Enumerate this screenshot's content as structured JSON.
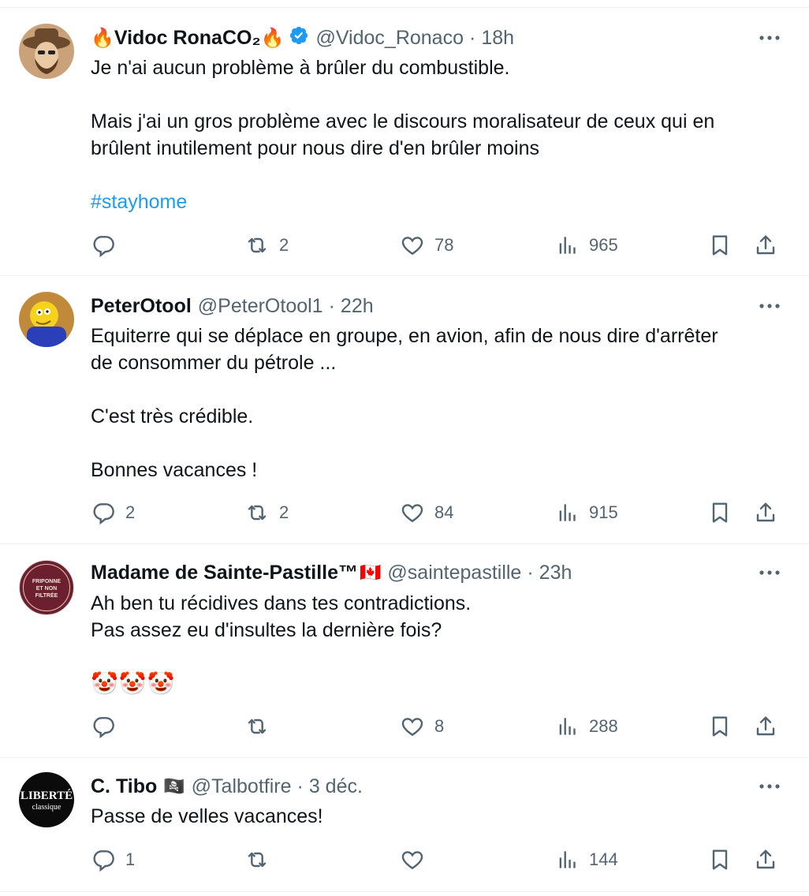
{
  "tweets": [
    {
      "name": "Vidoc RonaCO₂",
      "name_prefix_emoji": "🔥",
      "name_suffix_emoji": "🔥",
      "verified": true,
      "handle": "@Vidoc_Ronaco",
      "time": "18h",
      "paragraphs": [
        "Je n'ai aucun problème à brûler du combustible.",
        "Mais j'ai un gros problème avec le discours moralisateur de ceux qui en",
        "brûlent inutilement pour nous dire d'en brûler moins"
      ],
      "hashtag": "#stayhome",
      "replies": "",
      "reposts": "2",
      "likes": "78",
      "views": "965"
    },
    {
      "name": "PeterOtool",
      "handle": "@PeterOtool1",
      "time": "22h",
      "paragraphs": [
        "Equiterre qui se déplace en groupe, en avion, afin de nous dire d'arrêter",
        "de consommer du pétrole ...",
        "C'est très crédible.",
        "Bonnes vacances !"
      ],
      "replies": "2",
      "reposts": "2",
      "likes": "84",
      "views": "915"
    },
    {
      "name": "Madame de Sainte-Pastille™",
      "name_suffix_emoji": "🇨🇦",
      "handle": "@saintepastille",
      "time": "23h",
      "avatar_text": "FRIPONNE ET NON FILTRÉE",
      "paragraphs": [
        "Ah ben tu récidives dans tes contradictions.",
        "Pas assez eu d'insultes la dernière fois?"
      ],
      "emoji_line": "🤡🤡🤡",
      "replies": "",
      "reposts": "",
      "likes": "8",
      "views": "288"
    },
    {
      "name": "C. Tibo",
      "name_suffix_emoji": "🏴‍☠️",
      "handle": "@Talbotfire",
      "time": "3 déc.",
      "avatar_text": "LIBERTÉ",
      "avatar_subtext": "classique",
      "paragraphs": [
        "Passe de velles vacances!"
      ],
      "replies": "1",
      "reposts": "",
      "likes": "",
      "views": "144"
    }
  ],
  "colors": {
    "text": "#0f1419",
    "secondary": "#536471",
    "link": "#1d9bf0",
    "divider": "#eff3f4",
    "verified": "#1d9bf0"
  },
  "icons": [
    "reply-icon",
    "repost-icon",
    "like-icon",
    "views-icon",
    "bookmark-icon",
    "share-icon",
    "more-icon",
    "verified-badge-icon"
  ]
}
